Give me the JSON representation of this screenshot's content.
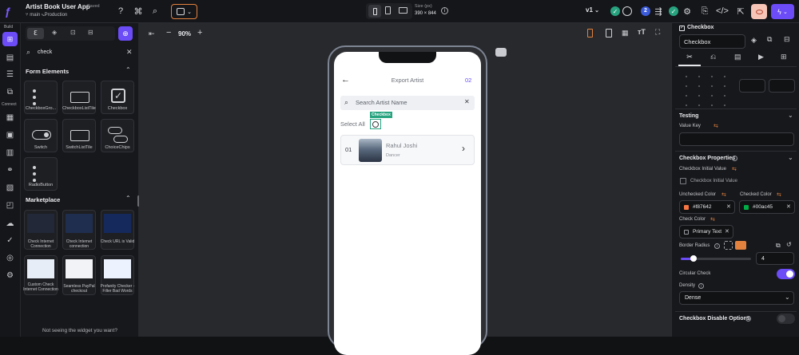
{
  "app": {
    "name": "Artist Book User App",
    "saved": "Saved",
    "branch": "main",
    "env": "Production"
  },
  "topbar": {
    "size_label": "Size (px)",
    "size_value": "390 × 844",
    "version": "v1",
    "user_count": "2"
  },
  "rail": {
    "build_label": "Build",
    "connect_label": "Connect"
  },
  "panel": {
    "search_value": "check",
    "form_section": "Form Elements",
    "form_items": [
      "CheckboxGro...",
      "CheckboxListTile",
      "Checkbox",
      "Switch",
      "SwitchListTile",
      "ChoiceChips",
      "RadioButton"
    ],
    "marketplace_section": "Marketplace",
    "market_items": [
      "Check Internet Connection",
      "Check Internet connection",
      "Check URL is Valid",
      "Custom Check Internet Connection",
      "Seamless PayPal checkout",
      "Profanity Checker - Filter Bad Words"
    ],
    "footer_text": "Not seeing the widget you want?"
  },
  "canvas": {
    "zoom": "90%"
  },
  "phone": {
    "title": "Export Artist",
    "step": "02",
    "search_placeholder": "Search Artist Name",
    "checkbox_tag": "Checkbox",
    "select_all": "Select All",
    "artist_index": "01",
    "artist_name": "Rahul Joshi",
    "artist_role": "Dancer"
  },
  "right": {
    "header": "Checkbox",
    "widget_name": "Checkbox",
    "testing_title": "Testing",
    "value_key_label": "Value Key",
    "props_title": "Checkbox Properties",
    "initial_value_label": "Checkbox Initial Value",
    "initial_value_check": "Checkbox Initial Value",
    "unchecked_label": "Unchecked Color",
    "unchecked_value": "#f87642",
    "checked_label": "Checked Color",
    "checked_value": "#00ac45",
    "check_color_label": "Check Color",
    "check_color_value": "Primary Text",
    "radius_label": "Border Radius",
    "radius_value": "4",
    "circular_label": "Circular Check",
    "density_label": "Density",
    "density_value": "Dense",
    "disable_title": "Checkbox Disable Options"
  },
  "colors": {
    "accent": "#6b4cf6",
    "teal": "#27a37f",
    "unchecked": "#f87642",
    "checked": "#00ac45"
  }
}
